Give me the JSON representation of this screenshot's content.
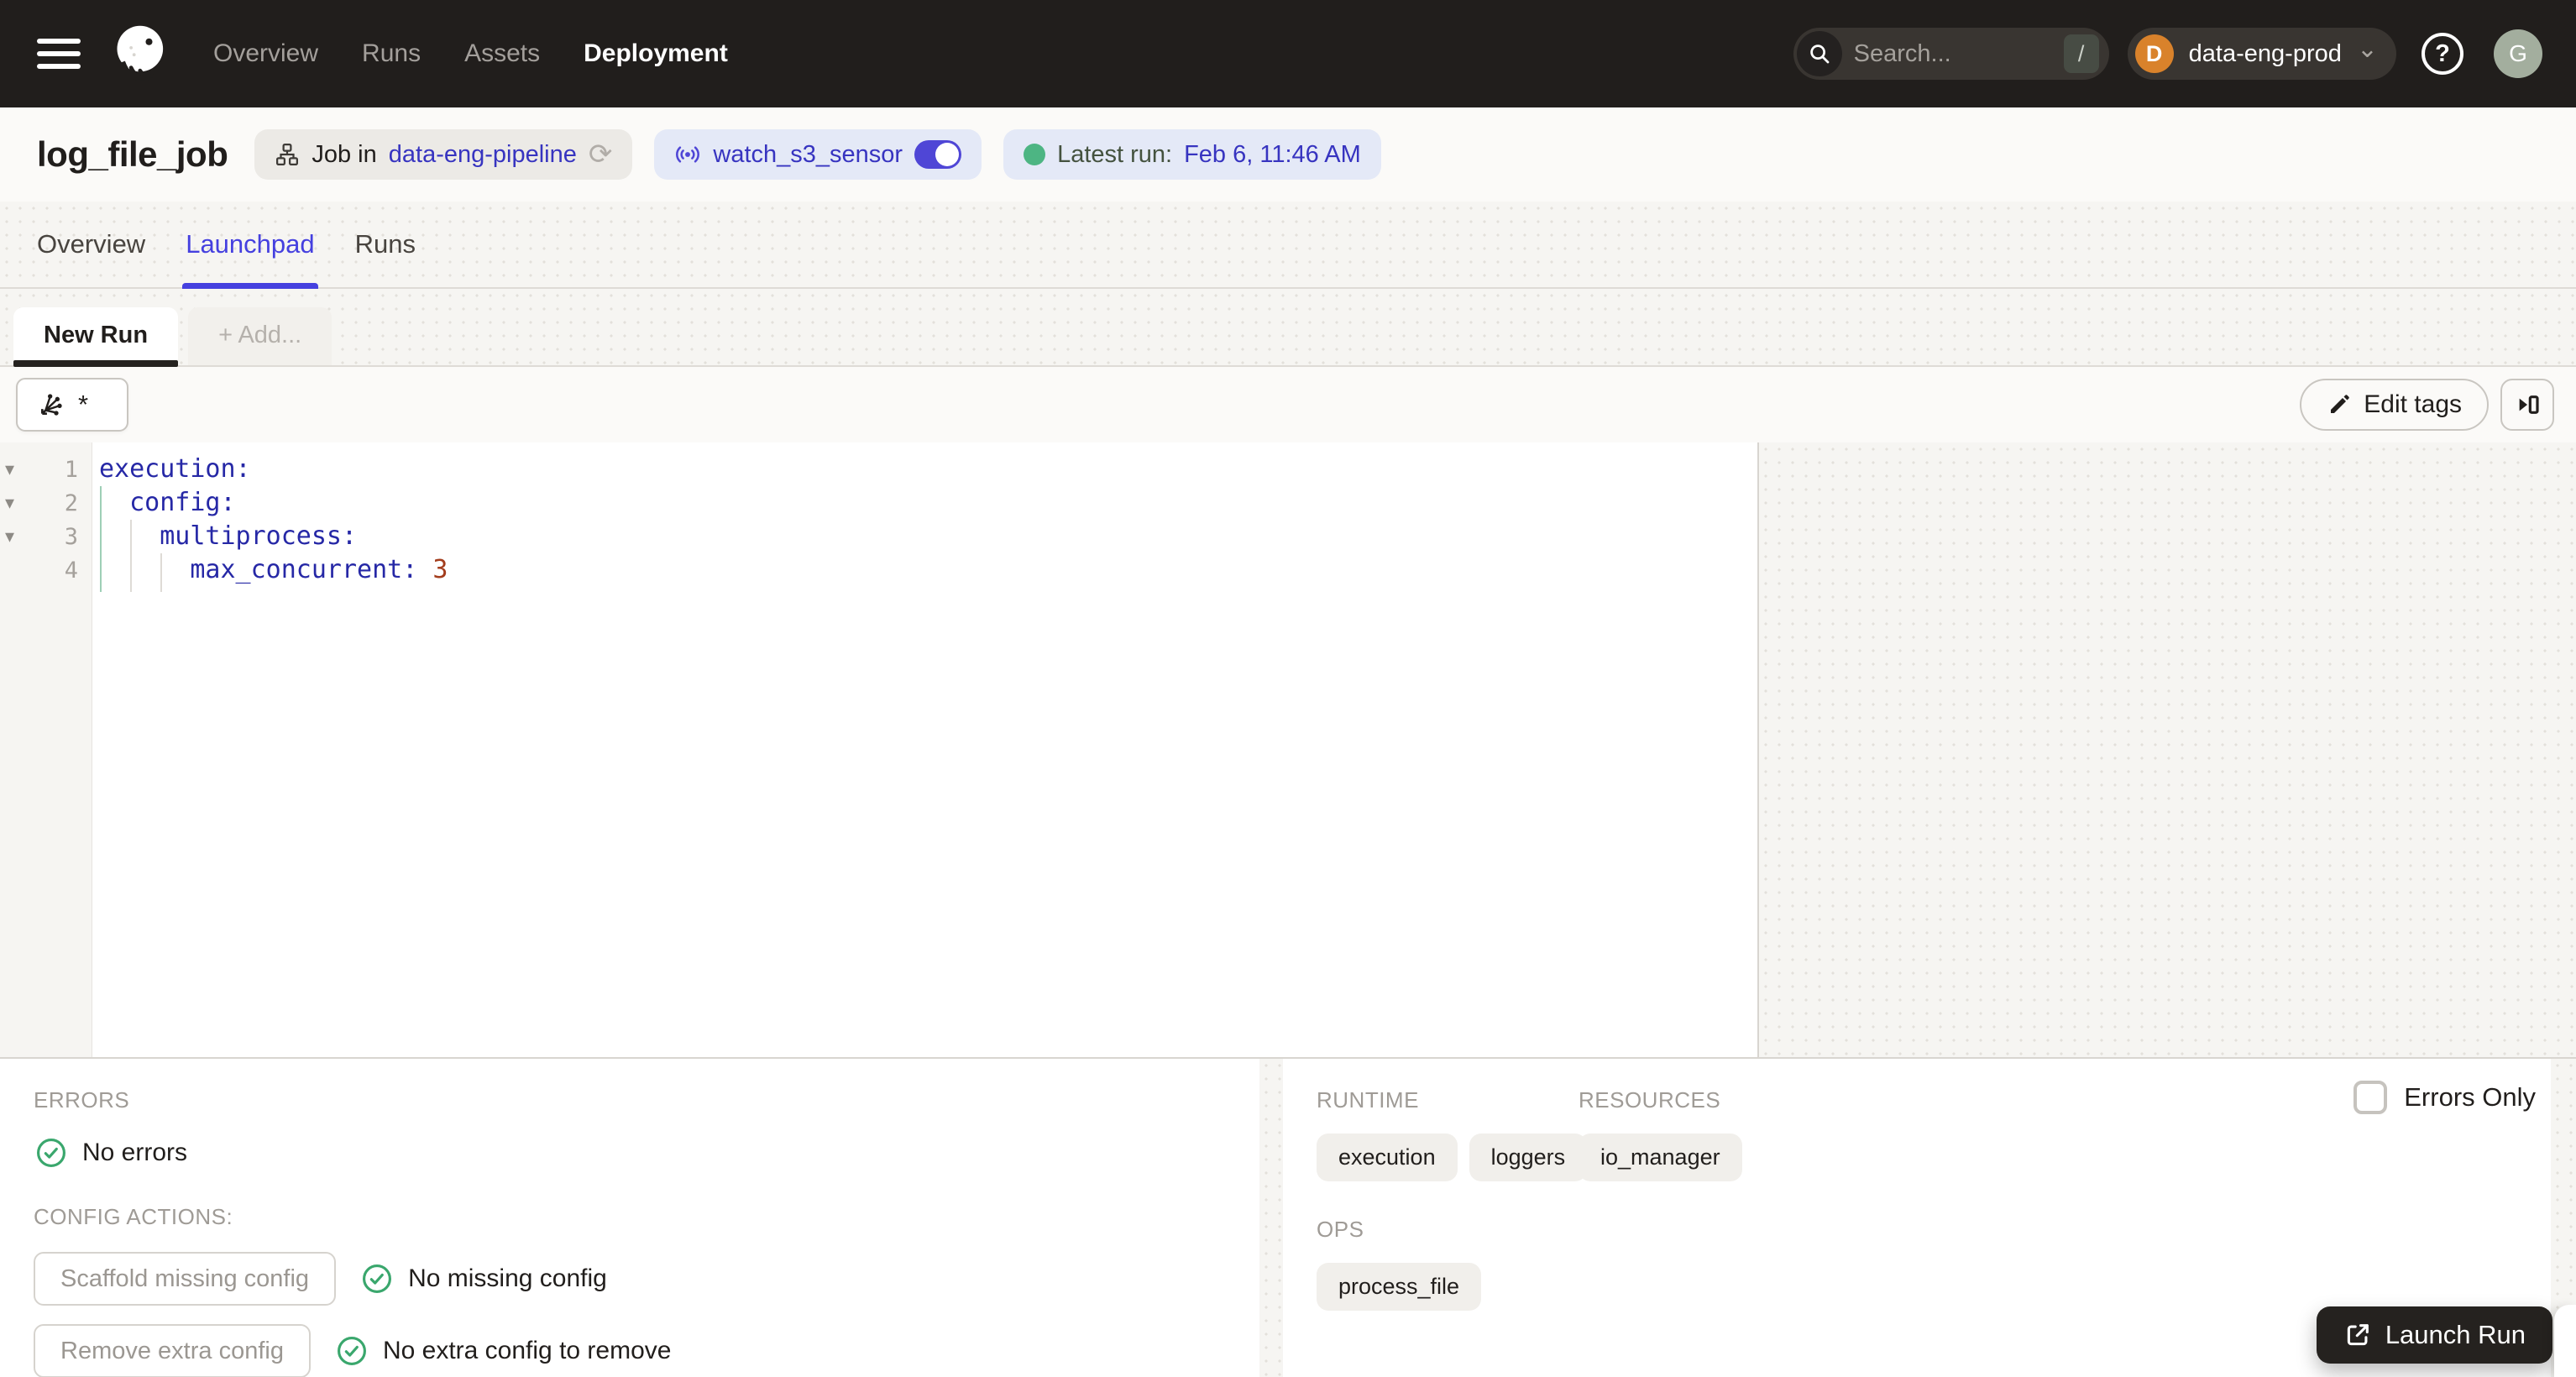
{
  "topnav": {
    "nav_items": [
      "Overview",
      "Runs",
      "Assets",
      "Deployment"
    ],
    "active_item": "Deployment",
    "search": {
      "placeholder": "Search...",
      "shortcut_key": "/"
    },
    "deployment": {
      "initial": "D",
      "name": "data-eng-prod"
    },
    "user_initial": "G"
  },
  "job_header": {
    "title": "log_file_job",
    "job_pill": {
      "prefix": "Job in",
      "repo_link": "data-eng-pipeline"
    },
    "sensor_pill": {
      "name": "watch_s3_sensor"
    },
    "latest_run_pill": {
      "label": "Latest run:",
      "value": "Feb 6, 11:46 AM"
    }
  },
  "page_tabs": {
    "items": [
      "Overview",
      "Launchpad",
      "Runs"
    ],
    "active": "Launchpad"
  },
  "launchpad": {
    "run_tab": "New Run",
    "add_tab": "+ Add...",
    "op_selector_value": "*",
    "edit_tags_label": "Edit tags"
  },
  "editor": {
    "fold_marker": "▾",
    "lines": [
      {
        "num": "1",
        "code": "execution:",
        "value": ""
      },
      {
        "num": "2",
        "code": "  config:",
        "value": ""
      },
      {
        "num": "3",
        "code": "    multiprocess:",
        "value": ""
      },
      {
        "num": "4",
        "code": "      max_concurrent: ",
        "value": "3"
      }
    ]
  },
  "bottom_left": {
    "errors_heading": "ERRORS",
    "no_errors": "No errors",
    "config_actions_heading": "CONFIG ACTIONS:",
    "scaffold_button": "Scaffold missing config",
    "no_missing_config": "No missing config",
    "remove_button": "Remove extra config",
    "no_extra_config": "No extra config to remove"
  },
  "bottom_right": {
    "runtime_heading": "RUNTIME",
    "resources_heading": "RESOURCES",
    "ops_heading": "OPS",
    "runtime_tags": [
      "execution",
      "loggers"
    ],
    "resources_tags": [
      "io_manager"
    ],
    "ops_tags": [
      "process_file"
    ],
    "errors_only_label": "Errors Only"
  },
  "launch_button_label": "Launch Run",
  "icons": {
    "refresh": "⟳",
    "chevron_down": "⌄"
  },
  "colors": {
    "nav_bg": "#211e1c",
    "accent_indigo": "#4540df",
    "link_indigo": "#3734c0",
    "success_green": "#4db583",
    "deployment_orange": "#d9822b",
    "code_key": "#2628a6",
    "code_value": "#a33d1d"
  }
}
